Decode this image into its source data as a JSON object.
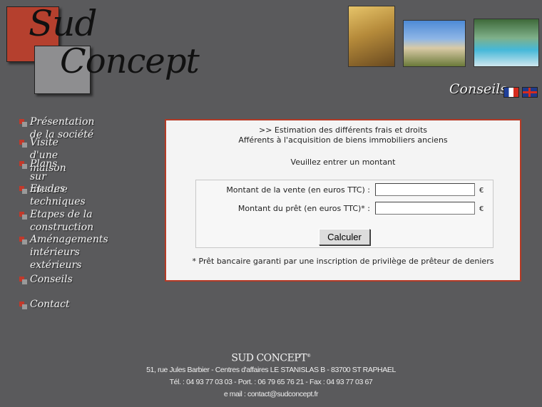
{
  "logo": {
    "word1": "Sud",
    "word2": "Concept"
  },
  "header": {
    "conseils_label": "Conseils"
  },
  "flags": [
    {
      "icon": "french-flag-icon"
    },
    {
      "icon": "uk-flag-icon"
    }
  ],
  "nav": {
    "items": [
      {
        "label": "Présentation de la société"
      },
      {
        "label": "Visite d'une maison"
      },
      {
        "label": "Plans sur mesure"
      },
      {
        "label": "Etudes techniques"
      },
      {
        "label": "Etapes de la construction"
      },
      {
        "label": "Aménagements\nintérieurs extérieurs"
      },
      {
        "label": "Conseils"
      },
      {
        "label": "Contact"
      }
    ]
  },
  "main": {
    "heading_line1": ">> Estimation des différents frais et droits",
    "heading_line2": "Afférents à l'acquisition de biens immobiliers anciens",
    "prompt": "Veuillez entrer un montant",
    "form": {
      "sale_label": "Montant de la vente (en euros TTC) :",
      "sale_value": "",
      "loan_label": "Montant du prêt (en euros TTC)* :",
      "loan_value": "",
      "currency": "€",
      "submit_label": "Calculer"
    },
    "footnote": "* Prêt bancaire garanti par une inscription de privilège de prêteur de deniers"
  },
  "footer": {
    "brand": "SUD CONCEPT",
    "brand_mark": "®",
    "address": "51, rue Jules Barbier - Centres d'affaires LE STANISLAS B - 83700 ST RAPHAEL",
    "phones": "Tél. : 04 93 77 03 03 - Port. : 06 79 65 76 21 - Fax : 04 93 77 03 67",
    "email": "e mail : contact@sudconcept.fr"
  },
  "colors": {
    "background": "#5a5a5c",
    "accent_red": "#b43a26",
    "panel": "#f4f4f4"
  }
}
